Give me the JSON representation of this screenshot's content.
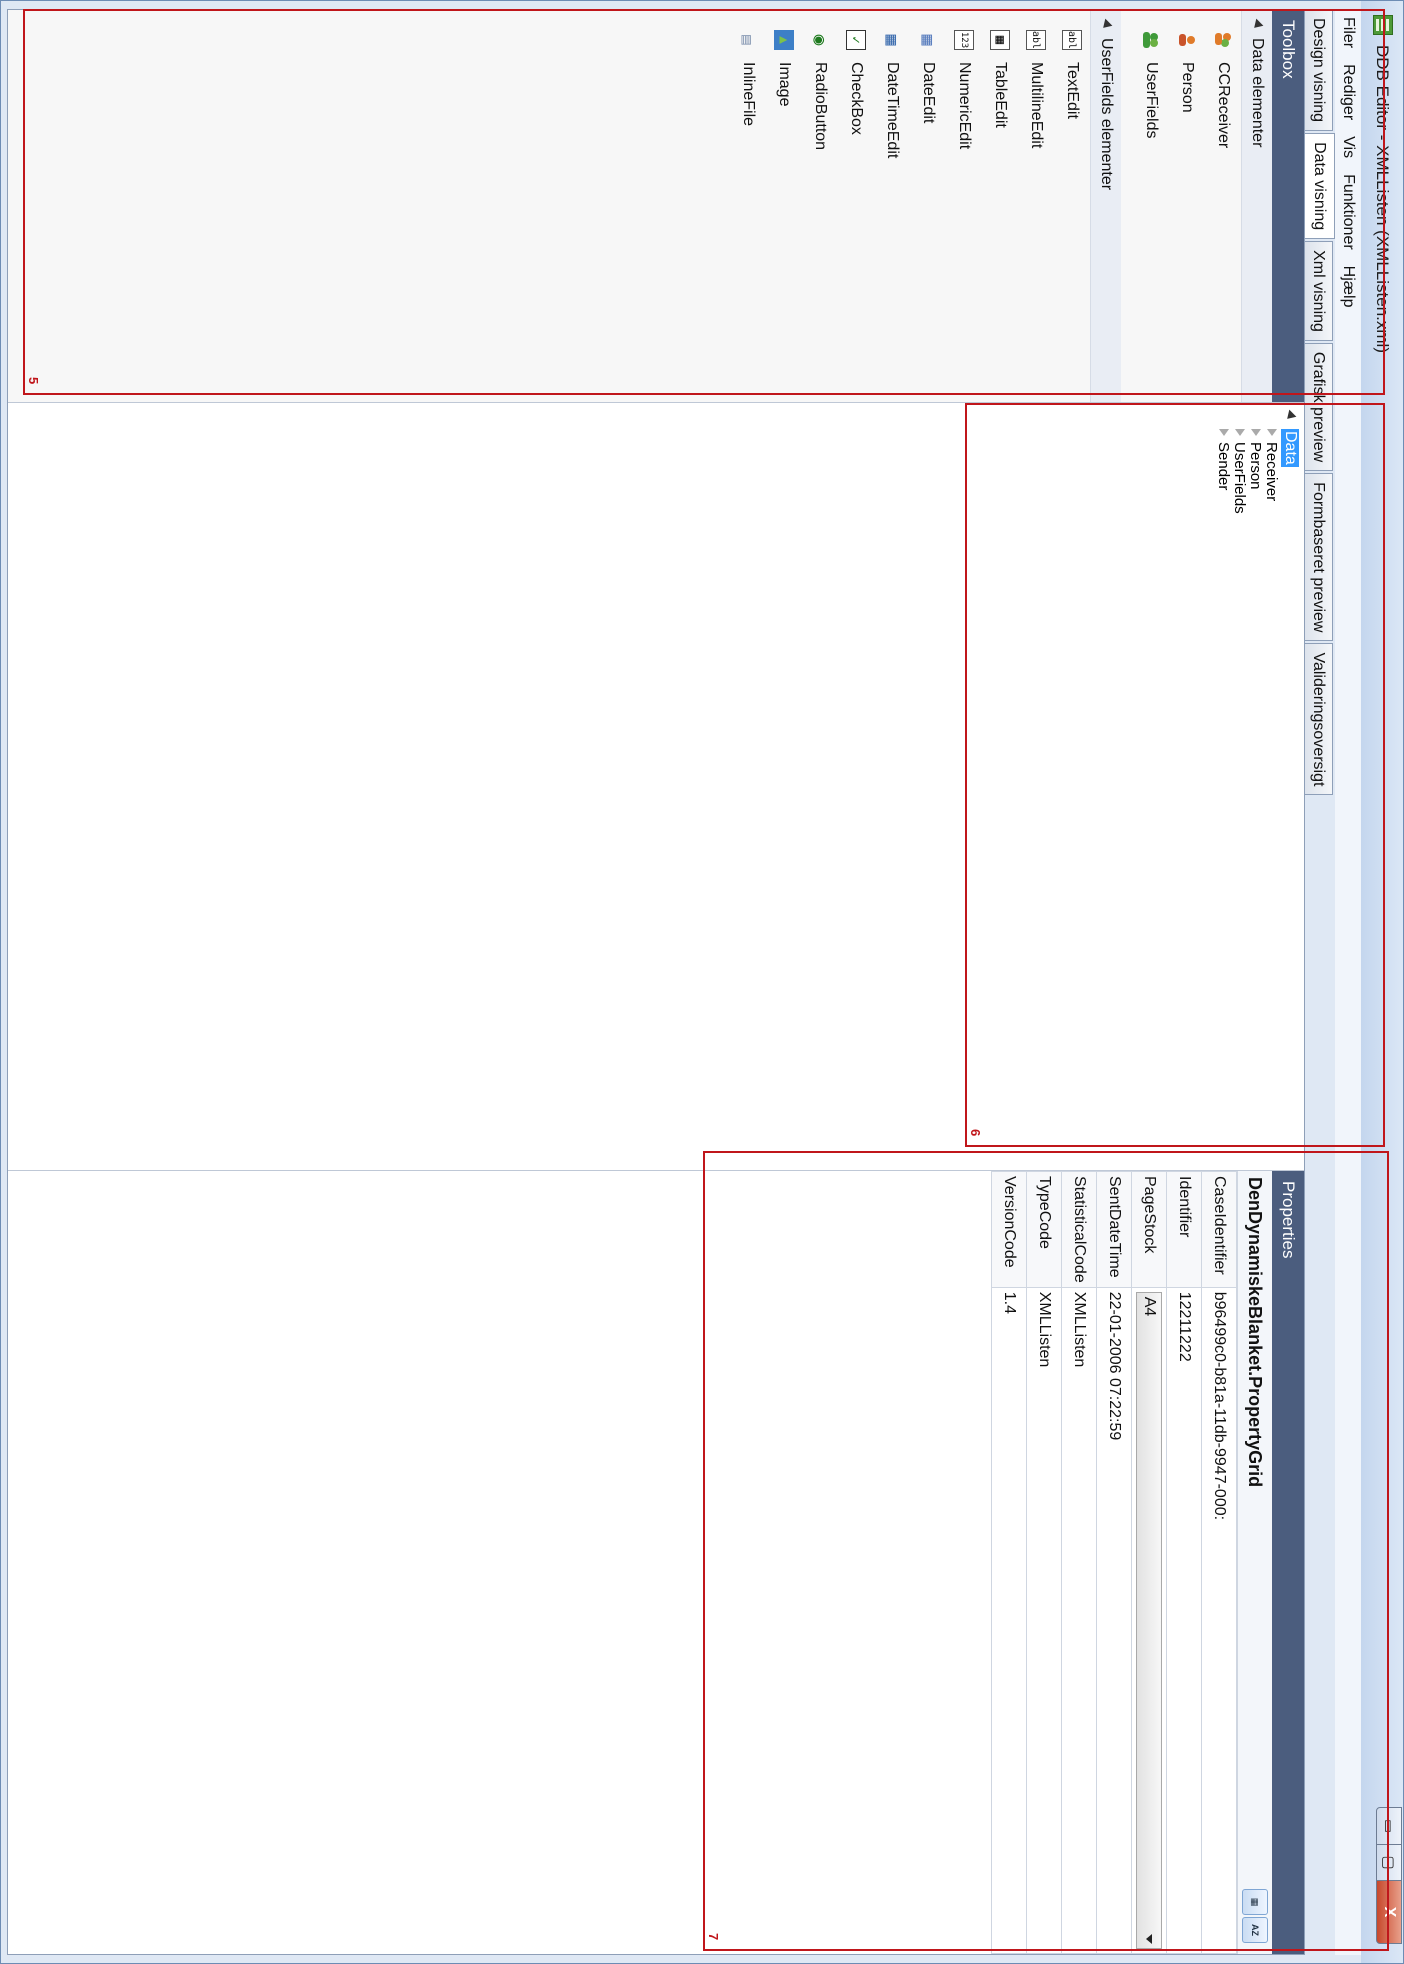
{
  "window": {
    "title": "DDB Editor - XMLListen (XMLListen.xml)",
    "minimize_symbol": "▭",
    "maximize_symbol": "▢",
    "close_symbol": "X"
  },
  "menu": [
    "Filer",
    "Rediger",
    "Vis",
    "Funktioner",
    "Hjælp"
  ],
  "tabs": [
    {
      "label": "Design visning"
    },
    {
      "label": "Data visning",
      "active": true
    },
    {
      "label": "Xml visning"
    },
    {
      "label": "Grafisk preview"
    },
    {
      "label": "Formbaseret preview"
    },
    {
      "label": "Valideringsoversigt"
    }
  ],
  "toolbox": {
    "title": "Toolbox",
    "groups": [
      {
        "label": "Data elementer",
        "items": [
          {
            "label": "CCReceiver",
            "icon": "person-group-icon"
          },
          {
            "label": "Person",
            "icon": "person-icon"
          },
          {
            "label": "UserFields",
            "icon": "user-fields-icon"
          }
        ]
      },
      {
        "label": "UserFields elementer",
        "items": [
          {
            "label": "TextEdit",
            "icon": "textedit-icon",
            "glyph": "abl"
          },
          {
            "label": "MultilineEdit",
            "icon": "multilineedit-icon",
            "glyph": "abl"
          },
          {
            "label": "TableEdit",
            "icon": "tableedit-icon",
            "glyph": "▦"
          },
          {
            "label": "NumericEdit",
            "icon": "numericedit-icon",
            "glyph": "123"
          },
          {
            "label": "DateEdit",
            "icon": "calendar-icon",
            "glyph": "▦"
          },
          {
            "label": "DateTimeEdit",
            "icon": "datetime-icon",
            "glyph": "▦"
          },
          {
            "label": "CheckBox",
            "icon": "checkbox-icon",
            "glyph": "✓"
          },
          {
            "label": "RadioButton",
            "icon": "radiobutton-icon",
            "glyph": "◉"
          },
          {
            "label": "Image",
            "icon": "image-icon",
            "glyph": "▲"
          },
          {
            "label": "InlineFile",
            "icon": "inlinefile-icon",
            "glyph": "▤"
          }
        ]
      }
    ]
  },
  "tree": {
    "root": "Data",
    "children": [
      "Receiver",
      "Person",
      "UserFields",
      "Sender"
    ]
  },
  "properties": {
    "panel_title": "Properties",
    "object_name": "DenDynamiskeBlanket.PropertyGrid",
    "rows": [
      {
        "key": "CaseIdentifier",
        "value": "b96499c0-b81a-11db-9947-000:"
      },
      {
        "key": "Identifier",
        "value": "12211222"
      },
      {
        "key": "PageStock",
        "value": "A4",
        "dropdown": true
      },
      {
        "key": "SentDateTime",
        "value": "22-01-2006 07:22:59"
      },
      {
        "key": "StatisticalCode",
        "value": "XMLListen"
      },
      {
        "key": "TypeCode",
        "value": "XMLListen"
      },
      {
        "key": "VersionCode",
        "value": "1.4"
      }
    ]
  },
  "annotations": [
    "5",
    "6",
    "7"
  ],
  "colors": {
    "panel_header": "#4b5d7e",
    "annotation_red": "#c0161b",
    "selection_blue": "#3399ff"
  }
}
